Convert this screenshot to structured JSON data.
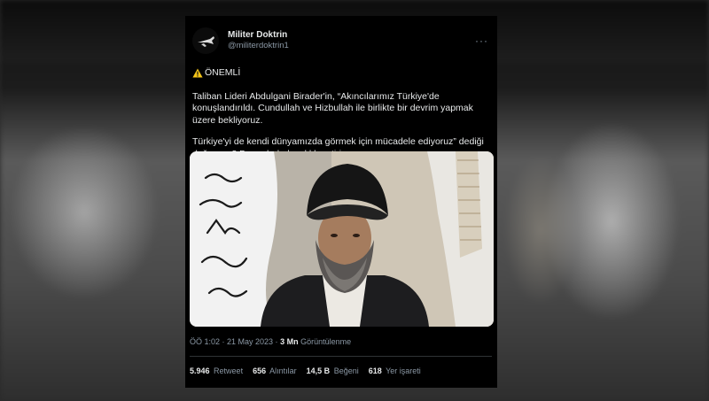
{
  "author": {
    "display_name": "Militer Doktrin",
    "handle": "@militerdoktrin1"
  },
  "more_label": "···",
  "tweet": {
    "alert_label": "ÖNEMLİ",
    "paragraph_1": "Taliban Lideri Abdulgani Birader'in, “Akıncılarımız Türkiye'de konuşlandırıldı. Cundullah ve Hizbullah ile birlikte bir devrim yapmak üzere bekliyoruz.",
    "paragraph_2": "Türkiye'yi de kendi dünyamızda görmek için mücadele ediyoruz” dediği doğru mu? Buna derhal açıklık getirin."
  },
  "meta": {
    "time_date": "ÖÖ 1:02 · 21 May 2023 ·",
    "views_count": "3 Mn",
    "views_label": "Görüntülenme"
  },
  "stats": {
    "retweets_count": "5.946",
    "retweets_label": "Retweet",
    "quotes_count": "656",
    "quotes_label": "Alıntılar",
    "likes_count": "14,5 B",
    "likes_label": "Beğeni",
    "bookmarks_count": "618",
    "bookmarks_label": "Yer işareti"
  },
  "colors": {
    "card_bg": "#000000",
    "text_primary": "#e7e9ea",
    "text_secondary": "#8b98a5",
    "warning_yellow": "#f5c518"
  },
  "icons": {
    "avatar": "jet-silhouette-icon",
    "alert": "warning-icon",
    "more": "more-horizontal-icon"
  }
}
